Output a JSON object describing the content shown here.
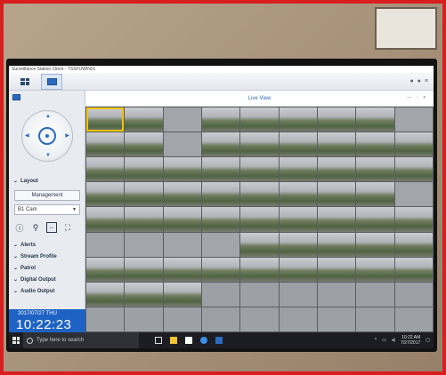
{
  "window": {
    "title": "Surveillance Station Client - TSSFUWIN01"
  },
  "live_view": {
    "title": "Live View",
    "controls": "— ▫ ✕"
  },
  "sidebar": {
    "layout_label": "Layout",
    "management_label": "Management",
    "camera_select": "B1 Cam",
    "sections": [
      "Alerts",
      "Stream Profile",
      "Patrol",
      "Digital Output",
      "Audio Output"
    ]
  },
  "clock": {
    "date": "2017/07/27 THU",
    "time": "10:22:23"
  },
  "taskbar": {
    "search_placeholder": "Type here to search",
    "tray_time": "10:22 AM",
    "tray_date": "7/27/2017"
  },
  "icons": {
    "ptz_up": "▲",
    "ptz_down": "▼",
    "ptz_left": "◀",
    "ptz_right": "▶",
    "info": "ⓘ",
    "pin": "⚲",
    "fit": "↔",
    "fullscreen": "⛶"
  },
  "grid": {
    "columns": 9,
    "rows": 9,
    "cells": [
      "sel",
      "feed",
      "blank",
      "feed",
      "feed",
      "feed",
      "feed",
      "feed",
      "blank",
      "feed",
      "feed",
      "blank",
      "feed",
      "feed",
      "feed",
      "feed",
      "feed",
      "feed",
      "feed",
      "feed",
      "feed",
      "feed",
      "feed",
      "feed",
      "feed",
      "feed",
      "feed",
      "feed",
      "feed",
      "feed",
      "feed",
      "feed",
      "feed",
      "feed",
      "feed",
      "blank",
      "feed",
      "feed",
      "feed",
      "feed",
      "feed",
      "feed",
      "feed",
      "feed",
      "feed",
      "blank",
      "blank",
      "blank",
      "blank",
      "feed",
      "feed",
      "feed",
      "feed",
      "feed",
      "feed",
      "feed",
      "feed",
      "feed",
      "feed",
      "feed",
      "feed",
      "feed",
      "feed",
      "feed",
      "feed",
      "feed",
      "empty",
      "empty",
      "empty",
      "empty",
      "empty",
      "empty",
      "empty",
      "empty",
      "empty",
      "empty",
      "empty",
      "empty",
      "empty",
      "empty",
      "empty"
    ]
  }
}
